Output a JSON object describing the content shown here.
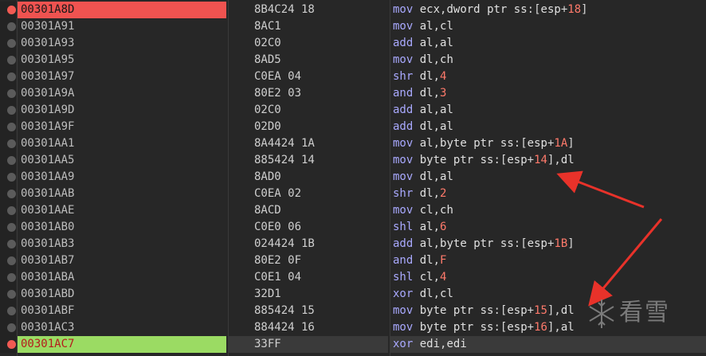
{
  "colors": {
    "background": "#272727",
    "selected_address_bg": "#ef5350",
    "current_address_bg": "#9bdb63",
    "mnemonic": "#a9a9ff",
    "number": "#ff7a6b",
    "arrow": "#e8322a"
  },
  "rows": [
    {
      "address": "00301A8D",
      "bytes": "8B4C24 18",
      "instr": "mov ecx,dword ptr ss:[esp+18]",
      "state": "selected",
      "bp": "red"
    },
    {
      "address": "00301A91",
      "bytes": "8AC1",
      "instr": "mov al,cl",
      "state": "",
      "bp": "grey"
    },
    {
      "address": "00301A93",
      "bytes": "02C0",
      "instr": "add al,al",
      "state": "",
      "bp": "grey"
    },
    {
      "address": "00301A95",
      "bytes": "8AD5",
      "instr": "mov dl,ch",
      "state": "",
      "bp": "grey"
    },
    {
      "address": "00301A97",
      "bytes": "C0EA 04",
      "instr": "shr dl,4",
      "state": "",
      "bp": "grey"
    },
    {
      "address": "00301A9A",
      "bytes": "80E2 03",
      "instr": "and dl,3",
      "state": "",
      "bp": "grey"
    },
    {
      "address": "00301A9D",
      "bytes": "02C0",
      "instr": "add al,al",
      "state": "",
      "bp": "grey"
    },
    {
      "address": "00301A9F",
      "bytes": "02D0",
      "instr": "add dl,al",
      "state": "",
      "bp": "grey"
    },
    {
      "address": "00301AA1",
      "bytes": "8A4424 1A",
      "instr": "mov al,byte ptr ss:[esp+1A]",
      "state": "",
      "bp": "grey"
    },
    {
      "address": "00301AA5",
      "bytes": "885424 14",
      "instr": "mov byte ptr ss:[esp+14],dl",
      "state": "",
      "bp": "grey"
    },
    {
      "address": "00301AA9",
      "bytes": "8AD0",
      "instr": "mov dl,al",
      "state": "",
      "bp": "grey"
    },
    {
      "address": "00301AAB",
      "bytes": "C0EA 02",
      "instr": "shr dl,2",
      "state": "",
      "bp": "grey"
    },
    {
      "address": "00301AAE",
      "bytes": "8ACD",
      "instr": "mov cl,ch",
      "state": "",
      "bp": "grey"
    },
    {
      "address": "00301AB0",
      "bytes": "C0E0 06",
      "instr": "shl al,6",
      "state": "",
      "bp": "grey"
    },
    {
      "address": "00301AB3",
      "bytes": "024424 1B",
      "instr": "add al,byte ptr ss:[esp+1B]",
      "state": "",
      "bp": "grey"
    },
    {
      "address": "00301AB7",
      "bytes": "80E2 0F",
      "instr": "and dl,F",
      "state": "",
      "bp": "grey"
    },
    {
      "address": "00301ABA",
      "bytes": "C0E1 04",
      "instr": "shl cl,4",
      "state": "",
      "bp": "grey"
    },
    {
      "address": "00301ABD",
      "bytes": "32D1",
      "instr": "xor dl,cl",
      "state": "",
      "bp": "grey"
    },
    {
      "address": "00301ABF",
      "bytes": "885424 15",
      "instr": "mov byte ptr ss:[esp+15],dl",
      "state": "",
      "bp": "grey"
    },
    {
      "address": "00301AC3",
      "bytes": "884424 16",
      "instr": "mov byte ptr ss:[esp+16],al",
      "state": "",
      "bp": "grey"
    },
    {
      "address": "00301AC7",
      "bytes": "33FF",
      "instr": "xor edi,edi",
      "state": "current",
      "bp": "red"
    }
  ],
  "watermark": {
    "text": "看雪",
    "icon": "snowflake-icon"
  }
}
